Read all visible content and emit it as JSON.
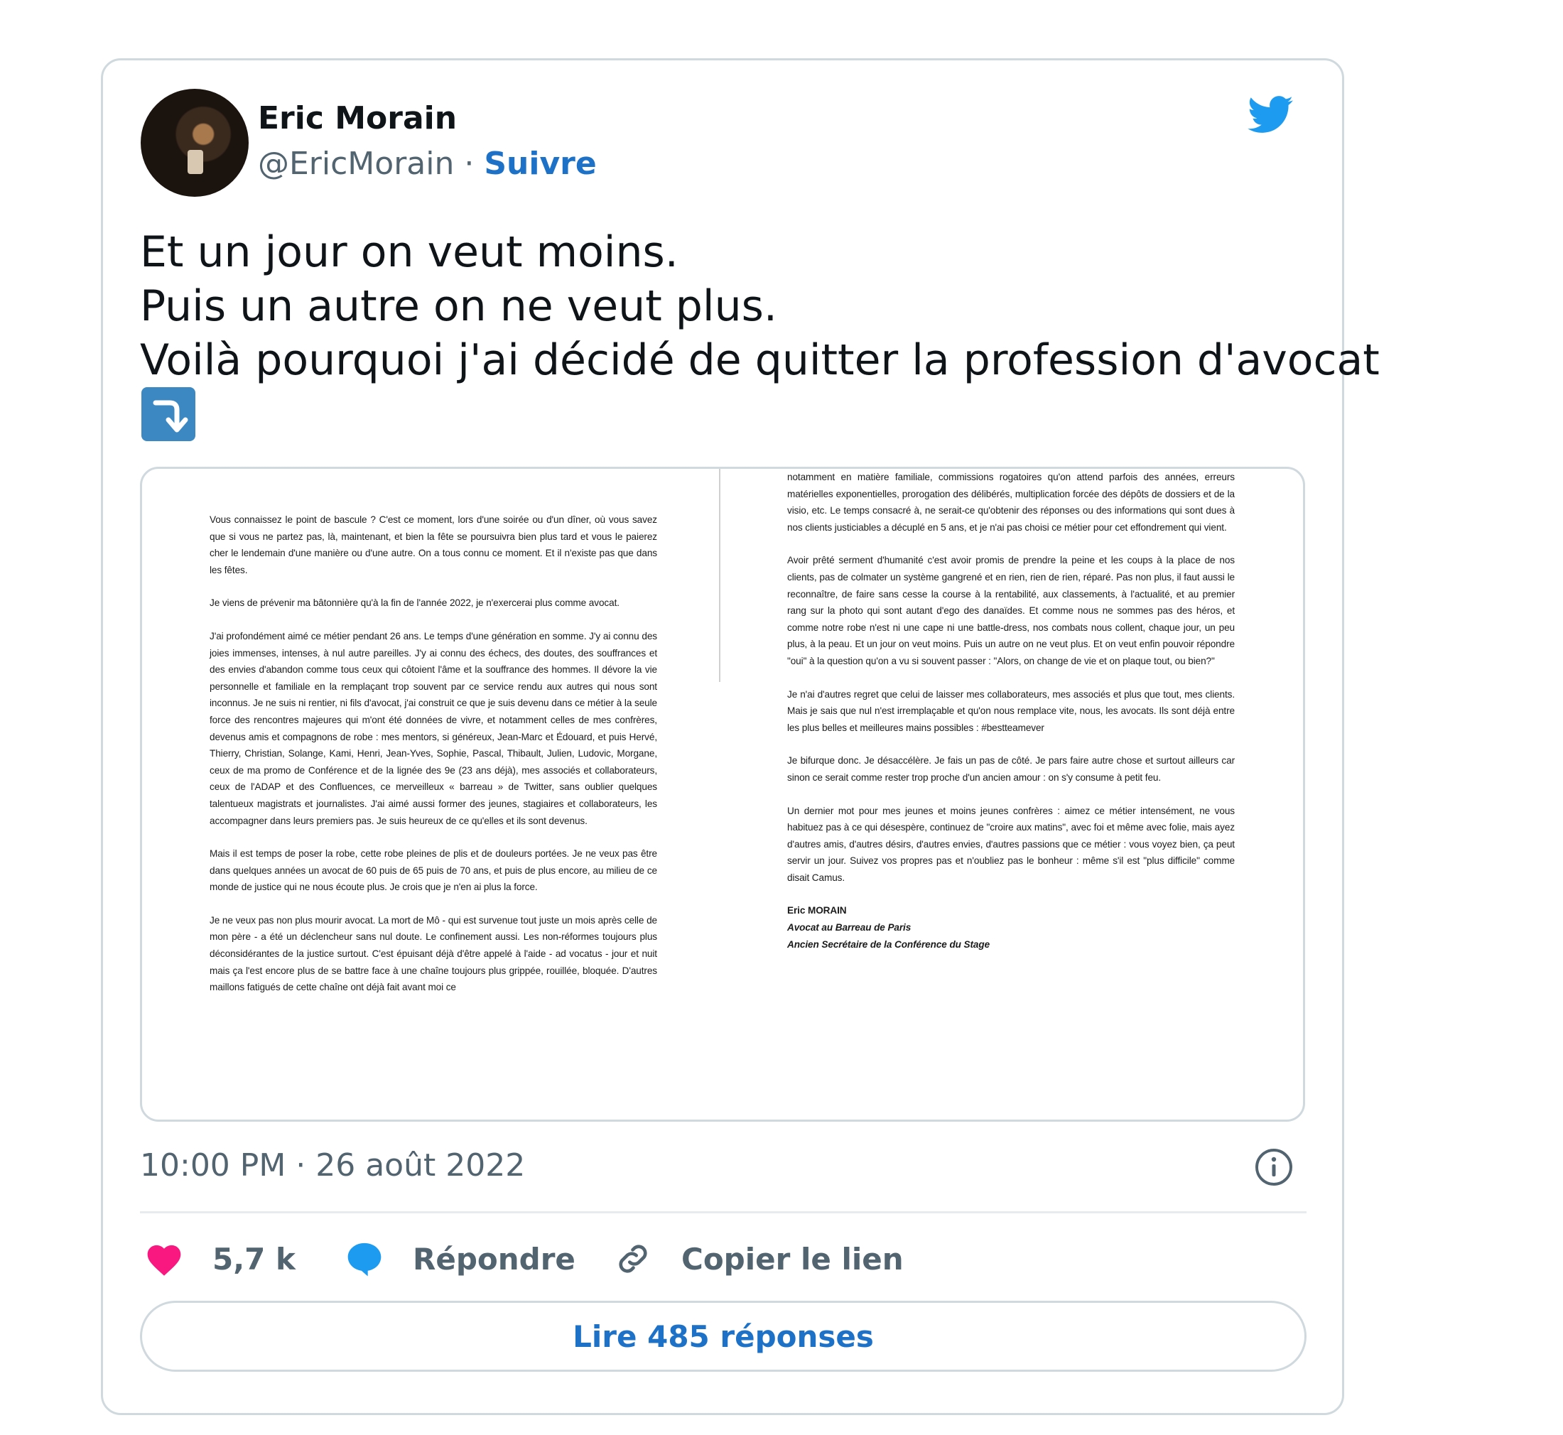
{
  "author": {
    "name": "Eric Morain",
    "handle": "@EricMorain",
    "separator": "·",
    "follow_label": "Suivre"
  },
  "tweet": {
    "lines": [
      "Et un jour on veut moins.",
      "Puis un autre on ne veut plus.",
      "Voilà pourquoi j'ai décidé de quitter la profession d'avocat"
    ],
    "emoji": "right-arrow-curving-down"
  },
  "document": {
    "left_paragraphs": [
      "Vous connaissez le point de bascule ? C'est ce moment, lors d'une soirée ou d'un dîner, où vous savez que si vous ne partez pas, là, maintenant, et bien la fête se poursuivra bien plus tard et vous le paierez cher le lendemain d'une manière ou d'une autre. On a tous connu ce moment. Et il n'existe pas que dans les fêtes.",
      "Je viens de prévenir ma bâtonnière qu'à la fin de l'année 2022, je n'exercerai plus comme avocat.",
      "J'ai profondément aimé ce métier pendant 26 ans. Le temps d'une génération en somme. J'y ai connu des joies immenses, intenses, à nul autre pareilles. J'y ai connu des échecs, des doutes, des souffrances et des envies d'abandon comme tous ceux qui côtoient l'âme et la souffrance des hommes. Il dévore la vie personnelle et familiale en la remplaçant trop souvent par ce service rendu aux autres qui nous sont inconnus. Je ne suis ni rentier, ni fils d'avocat, j'ai construit ce que je suis devenu dans ce métier à la seule force des rencontres majeures qui m'ont été données de vivre, et notamment celles de mes confrères, devenus amis et compagnons de robe : mes mentors, si généreux, Jean-Marc et Édouard, et puis Hervé, Thierry, Christian, Solange, Kami, Henri, Jean-Yves, Sophie, Pascal, Thibault, Julien, Ludovic, Morgane, ceux de ma promo de Conférence et de la lignée des 9e (23 ans déjà), mes associés et collaborateurs, ceux de l'ADAP et des Confluences, ce merveilleux « barreau » de Twitter, sans oublier quelques talentueux magistrats et journalistes. J'ai aimé aussi former des jeunes, stagiaires et collaborateurs, les accompagner dans leurs premiers pas. Je suis heureux de ce qu'elles et ils sont devenus.",
      "Mais il est temps de poser la robe, cette robe pleines de plis et de douleurs portées. Je ne veux pas être dans quelques années un avocat de 60 puis de 65 puis de 70 ans, et puis de plus encore, au milieu de ce monde de justice qui ne nous écoute plus. Je crois que je n'en ai plus la force.",
      "Je ne veux pas non plus mourir avocat. La mort de Mô - qui est survenue tout juste un mois après celle de mon père - a été un déclencheur sans nul doute. Le confinement aussi. Les non-réformes toujours plus déconsidérantes de la justice surtout. C'est épuisant déjà d'être appelé à l'aide - ad vocatus - jour et nuit mais ça l'est encore plus de se battre face à une chaîne toujours plus grippée, rouillée, bloquée. D'autres maillons fatigués de cette chaîne ont déjà fait avant moi ce"
    ],
    "right_paragraphs": [
      "notamment en matière familiale, commissions rogatoires qu'on attend parfois des années, erreurs matérielles exponentielles, prorogation des délibérés, multiplication forcée des dépôts de dossiers et de la visio, etc. Le temps consacré à, ne serait-ce qu'obtenir des réponses ou des informations qui sont dues à nos clients justiciables a décuplé en 5 ans, et je n'ai pas choisi ce métier pour cet effondrement qui vient.",
      "Avoir prêté serment d'humanité c'est avoir promis de prendre la peine et les coups à la place de nos clients, pas de colmater un système gangrené et en rien, rien de rien, réparé. Pas non plus, il faut aussi le reconnaître, de faire sans cesse la course à la rentabilité, aux classements, à l'actualité, et au premier rang sur la photo qui sont autant d'ego des danaïdes. Et comme nous ne sommes pas des héros, et comme notre robe n'est ni une cape ni une battle-dress, nos combats nous collent, chaque jour, un peu plus, à la peau. Et un jour on veut moins. Puis un autre on ne veut plus. Et on veut enfin pouvoir répondre \"oui\" à la question qu'on a vu si souvent passer : \"Alors, on change de vie et on plaque tout, ou bien?\"",
      "Je n'ai d'autres regret que celui de laisser mes collaborateurs, mes associés et plus que tout, mes clients. Mais je sais que nul n'est irremplaçable et qu'on nous remplace vite, nous, les avocats. Ils sont déjà entre les plus belles et meilleures mains possibles : #bestteamever",
      "Je bifurque donc. Je désaccélère. Je fais un pas de côté. Je pars faire autre chose et surtout ailleurs car sinon ce serait comme rester trop proche d'un ancien amour : on s'y consume à petit feu.",
      "Un dernier mot pour mes jeunes et moins jeunes confrères : aimez ce métier intensément, ne vous habituez pas à ce qui désespère, continuez de \"croire aux matins\", avec foi et même avec folie, mais ayez d'autres amis, d'autres désirs, d'autres envies, d'autres passions que ce métier : vous voyez bien, ça peut servir un jour. Suivez vos propres pas et n'oubliez pas le bonheur : même s'il est \"plus difficile\" comme disait Camus."
    ],
    "signature": {
      "name": "Eric MORAIN",
      "role1": "Avocat au Barreau de Paris",
      "role2": "Ancien Secrétaire de la Conférence du Stage"
    }
  },
  "timestamp": "10:00 PM · 26 août 2022",
  "actions": {
    "likes": "5,7 k",
    "reply_label": "Répondre",
    "copy_label": "Copier le lien"
  },
  "replies_button": "Lire 485 réponses",
  "colors": {
    "link_blue": "#1d72c8",
    "twitter_blue": "#1d9bf0",
    "heart_pink": "#f91880",
    "border": "#cfd9de",
    "muted_text": "#536471"
  },
  "icons": {
    "brand": "twitter-bird-icon",
    "info": "info-icon",
    "like": "heart-icon",
    "reply": "reply-bubble-icon",
    "copy": "link-icon"
  }
}
